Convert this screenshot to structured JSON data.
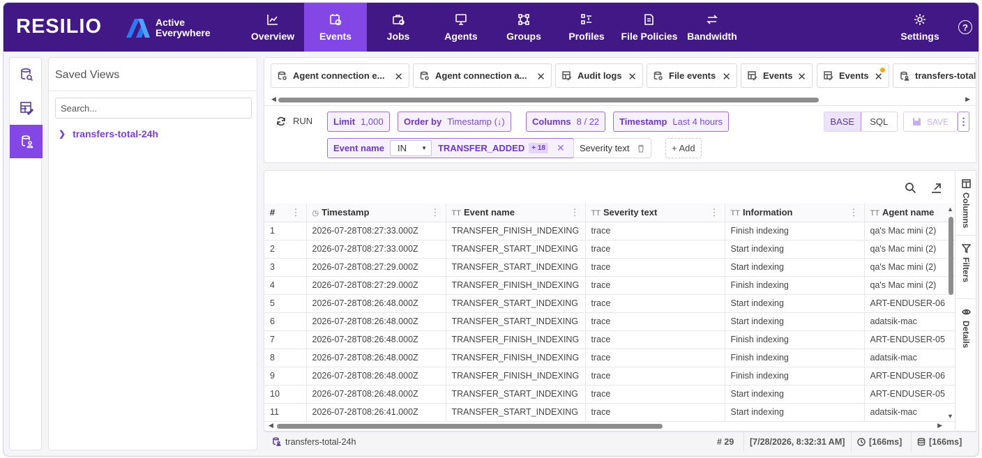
{
  "brand": {
    "name": "RESILIO",
    "product_line1": "Active",
    "product_line2": "Everywhere"
  },
  "nav": {
    "items": [
      {
        "label": "Overview",
        "icon": "chart-line-icon",
        "active": false
      },
      {
        "label": "Events",
        "icon": "calendar-clock-icon",
        "active": true
      },
      {
        "label": "Jobs",
        "icon": "briefcase-icon",
        "active": false
      },
      {
        "label": "Agents",
        "icon": "monitor-icon",
        "active": false
      },
      {
        "label": "Groups",
        "icon": "network-icon",
        "active": false
      },
      {
        "label": "Profiles",
        "icon": "profile-list-icon",
        "active": false
      },
      {
        "label": "File Policies",
        "icon": "file-policy-icon",
        "active": false
      },
      {
        "label": "Bandwidth",
        "icon": "transfer-arrows-icon",
        "active": false
      },
      {
        "label": "Settings",
        "icon": "gear-icon",
        "active": false
      }
    ],
    "help": "?"
  },
  "saved_views": {
    "title": "Saved Views",
    "search_placeholder": "Search...",
    "items": [
      {
        "label": "transfers-total-24h"
      }
    ]
  },
  "tabs": [
    {
      "label": "Agent connection e...",
      "icon": "database-search-icon",
      "closable": true
    },
    {
      "label": "Agent connection a...",
      "icon": "database-search-icon",
      "closable": true
    },
    {
      "label": "Audit logs",
      "icon": "table-edit-icon",
      "closable": true
    },
    {
      "label": "File events",
      "icon": "database-search-icon",
      "closable": true
    },
    {
      "label": "Events",
      "icon": "table-edit-icon",
      "closable": true
    },
    {
      "label": "Events",
      "icon": "table-edit-icon",
      "closable": true,
      "unsaved": true
    },
    {
      "label": "transfers-total",
      "icon": "database-user-icon",
      "closable": false
    }
  ],
  "query": {
    "run_label": "RUN",
    "limit": {
      "label": "Limit",
      "value": "1,000"
    },
    "order": {
      "label": "Order by",
      "value": "Timestamp (↓)"
    },
    "columns": {
      "label": "Columns",
      "value": "8 / 22"
    },
    "timestamp": {
      "label": "Timestamp",
      "value": "Last 4 hours"
    },
    "filter": {
      "label": "Event name",
      "op": "IN",
      "value": "TRANSFER_ADDED",
      "extra": "+ 18"
    },
    "severity": {
      "label": "Severity text"
    },
    "add_label": "+ Add",
    "mode_base": "BASE",
    "mode_sql": "SQL",
    "save_label": "SAVE",
    "more": "⋮"
  },
  "grid": {
    "columns": [
      "#",
      "Timestamp",
      "Event name",
      "Severity text",
      "Information",
      "Agent name"
    ],
    "rows": [
      [
        "1",
        "2026-07-28T08:27:33.000Z",
        "TRANSFER_FINISH_INDEXING",
        "trace",
        "Finish indexing",
        "qa's Mac mini (2)"
      ],
      [
        "2",
        "2026-07-28T08:27:33.000Z",
        "TRANSFER_START_INDEXING",
        "trace",
        "Start indexing",
        "qa's Mac mini (2)"
      ],
      [
        "3",
        "2026-07-28T08:27:29.000Z",
        "TRANSFER_START_INDEXING",
        "trace",
        "Start indexing",
        "qa's Mac mini (2)"
      ],
      [
        "4",
        "2026-07-28T08:27:29.000Z",
        "TRANSFER_FINISH_INDEXING",
        "trace",
        "Finish indexing",
        "qa's Mac mini (2)"
      ],
      [
        "5",
        "2026-07-28T08:26:48.000Z",
        "TRANSFER_START_INDEXING",
        "trace",
        "Start indexing",
        "ART-ENDUSER-06"
      ],
      [
        "6",
        "2026-07-28T08:26:48.000Z",
        "TRANSFER_START_INDEXING",
        "trace",
        "Start indexing",
        "adatsik-mac"
      ],
      [
        "7",
        "2026-07-28T08:26:48.000Z",
        "TRANSFER_FINISH_INDEXING",
        "trace",
        "Finish indexing",
        "ART-ENDUSER-05"
      ],
      [
        "8",
        "2026-07-28T08:26:48.000Z",
        "TRANSFER_FINISH_INDEXING",
        "trace",
        "Finish indexing",
        "adatsik-mac"
      ],
      [
        "9",
        "2026-07-28T08:26:48.000Z",
        "TRANSFER_FINISH_INDEXING",
        "trace",
        "Finish indexing",
        "ART-ENDUSER-06"
      ],
      [
        "10",
        "2026-07-28T08:26:48.000Z",
        "TRANSFER_START_INDEXING",
        "trace",
        "Start indexing",
        "ART-ENDUSER-05"
      ],
      [
        "11",
        "2026-07-28T08:26:41.000Z",
        "TRANSFER_START_INDEXING",
        "trace",
        "Start indexing",
        "adatsik-mac"
      ]
    ]
  },
  "side_panel": {
    "columns": "Columns",
    "filters": "Filters",
    "details": "Details"
  },
  "footer": {
    "view_name": "transfers-total-24h",
    "row_count": "# 29",
    "time": "[7/28/2026, 8:32:31 AM]",
    "duration1": "[166ms]",
    "duration2": "[166ms]"
  },
  "colors": {
    "nav_bg": "#421887",
    "accent": "#8247e5"
  }
}
